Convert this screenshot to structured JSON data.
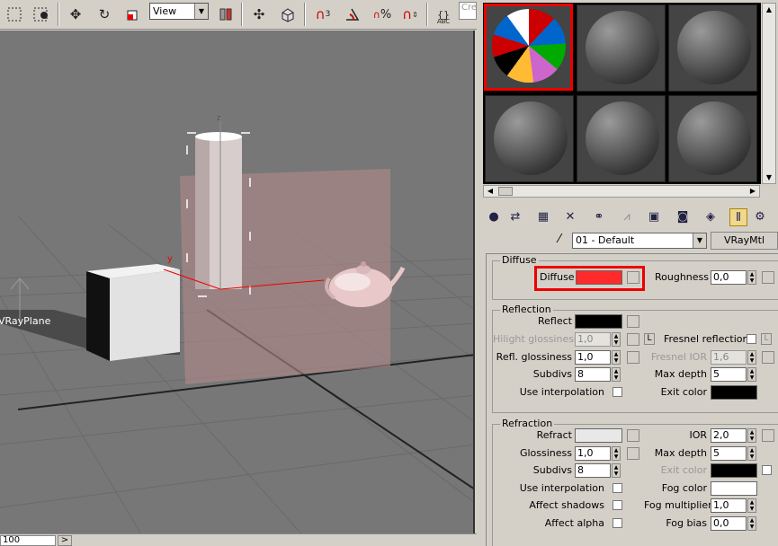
{
  "toolbar": {
    "view_dropdown": "View",
    "create_field": "Cre",
    "icons": [
      "select-icon",
      "select-region-icon",
      "move-icon",
      "rotate-icon",
      "scale-icon",
      "mirror-icon",
      "align-icon",
      "snap-icon",
      "3d-snap-icon",
      "angle-snap-icon",
      "percent-snap-icon",
      "spinner-snap-icon",
      "edit-named-selection-icon"
    ],
    "snap_label": "3",
    "percent_label": "%"
  },
  "viewport": {
    "object_label": "VRayPlane",
    "axis_y": "y",
    "axis_z": "z"
  },
  "status": {
    "frame_value": "100",
    "arrow": ">"
  },
  "material_editor": {
    "slots": 6,
    "active_slot": 0,
    "material_name": "01 - Default",
    "material_type": "VRayMtl",
    "diffuse": {
      "section_title": "Diffuse",
      "diffuse_label": "Diffuse",
      "diffuse_color": "#ff2a2a",
      "roughness_label": "Roughness",
      "roughness_value": "0,0"
    },
    "reflection": {
      "section_title": "Reflection",
      "reflect_label": "Reflect",
      "reflect_color": "#000000",
      "hilight_label": "Hilight glossiness",
      "hilight_value": "1,0",
      "lock_label": "L",
      "fresnel_label": "Fresnel reflections",
      "fresnel_lock": "L",
      "refl_gloss_label": "Refl. glossiness",
      "refl_gloss_value": "1,0",
      "fresnel_ior_label": "Fresnel IOR",
      "fresnel_ior_value": "1,6",
      "subdivs_label": "Subdivs",
      "subdivs_value": "8",
      "max_depth_label": "Max depth",
      "max_depth_value": "5",
      "use_interp_label": "Use interpolation",
      "exit_color_label": "Exit color",
      "exit_color": "#000000"
    },
    "refraction": {
      "section_title": "Refraction",
      "refract_label": "Refract",
      "refract_color": "#e8e8e8",
      "ior_label": "IOR",
      "ior_value": "2,0",
      "gloss_label": "Glossiness",
      "gloss_value": "1,0",
      "max_depth_label": "Max depth",
      "max_depth_value": "5",
      "subdivs_label": "Subdivs",
      "subdivs_value": "8",
      "exit_color_label": "Exit color",
      "exit_color": "#000000",
      "use_interp_label": "Use interpolation",
      "fog_color_label": "Fog color",
      "fog_color": "#ffffff",
      "affect_shadows_label": "Affect shadows",
      "fog_mult_label": "Fog multiplier",
      "fog_mult_value": "1,0",
      "affect_alpha_label": "Affect alpha",
      "fog_bias_label": "Fog bias",
      "fog_bias_value": "0,0"
    }
  }
}
